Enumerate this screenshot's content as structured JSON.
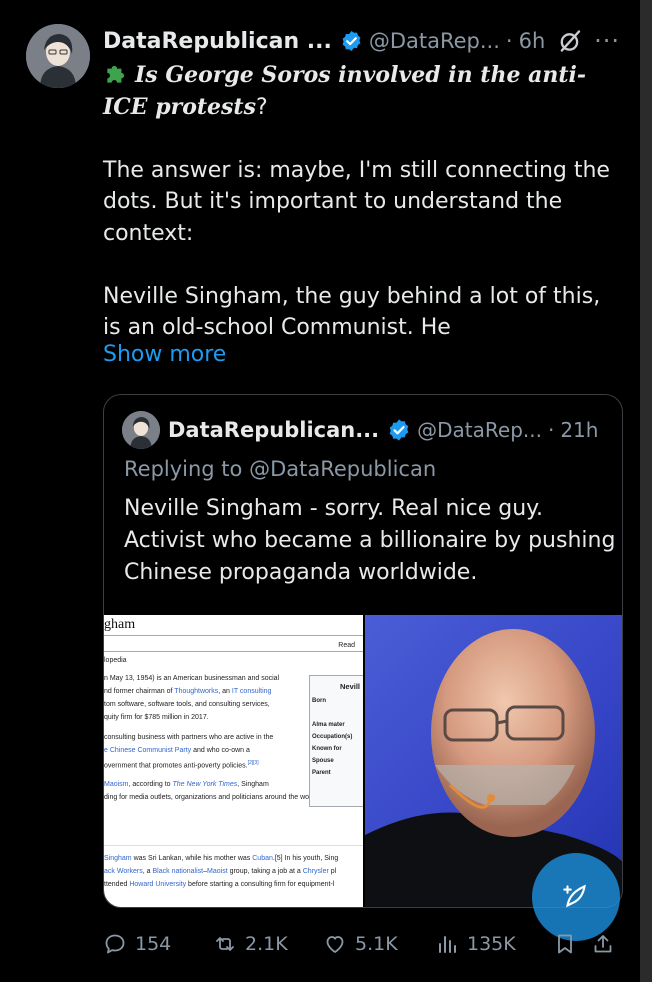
{
  "post": {
    "author_name": "DataRepublican ...",
    "handle": "@DataRep...",
    "separator": "·",
    "time": "6h",
    "more_label": "···",
    "headline_emoji": "puzzle-piece",
    "headline": "Is George Soros involved in the anti-ICE protests",
    "headline_end": "?",
    "para1": "The answer is: maybe, I'm still connecting the dots. But it's important to understand the context:",
    "para2": "Neville Singham, the guy behind a lot of this, is an old-school Communist. He",
    "show_more": "Show more"
  },
  "quote": {
    "author_name": "DataRepublican...",
    "handle": "@DataRep...",
    "separator": "·",
    "time": "21h",
    "replying_to": "Replying to @DataRepublican",
    "text": "Neville Singham - sorry. Real nice guy. Activist who became a billionaire by pushing Chinese propaganda worldwide.",
    "wiki": {
      "title": "gham",
      "read": "Read",
      "tagline": "lopedia",
      "l1": "n May 13, 1954) is an American businessman and social",
      "l2a": "nd former chairman of ",
      "l2b": "Thoughtworks",
      "l2c": ", an ",
      "l2d": "IT consulting",
      "l3": "tom software, software tools, and consulting services,",
      "l4": "quity firm for $785 million in 2017.",
      "l5": " consulting business with partners who are active in the",
      "l6a": "e Chinese Communist Party",
      "l6b": " and who co-own a",
      "l7": "overnment that promotes anti-poverty policies.",
      "l7ref": "[2][3]",
      "l8a": "Maoism",
      "l8b": ", according to ",
      "l8c": "The New York Times",
      "l8d": ", Singham",
      "l9": "ding for media outlets, organizations and politicians around the world that p",
      "l10a": "Singham",
      "l10b": " was Sri Lankan, while his mother was ",
      "l10c": "Cuban",
      "l10d": ".[5] In his youth, Sing",
      "l11a": "ack Workers",
      "l11b": ", a ",
      "l11c": "Black nationalist",
      "l11d": "–",
      "l11e": "Maoist",
      "l11f": " group, taking a job at a ",
      "l11g": "Chrysler",
      "l11h": " pl",
      "l12a": "ttended ",
      "l12b": "Howard University",
      "l12c": " before starting a consulting firm for equipment-l",
      "infobox_name": "Nevill",
      "infobox_born": "Born",
      "infobox_alma": "Alma mater",
      "infobox_occ": "Occupation(s)",
      "infobox_known": "Known for",
      "infobox_spouse": "Spouse",
      "infobox_parent": "Parent"
    }
  },
  "actions": {
    "replies": "154",
    "reposts": "2.1K",
    "likes": "5.1K",
    "views": "135K"
  },
  "colors": {
    "background": "#000000",
    "text": "#e7e9ea",
    "muted": "#8b98a5",
    "accent": "#1d9bf0",
    "verified": "#1d9bf0"
  }
}
